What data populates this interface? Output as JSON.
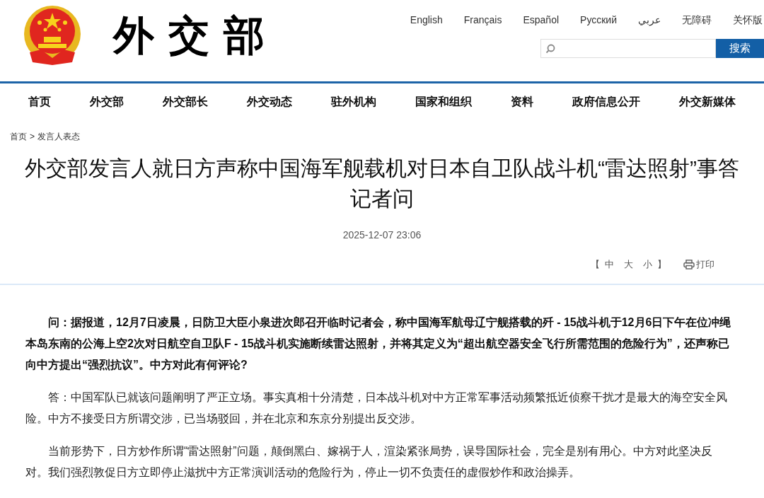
{
  "header": {
    "logo_text": "外交部",
    "languages": [
      "English",
      "Français",
      "Español",
      "Русский",
      "عربي",
      "无障碍",
      "关怀版"
    ],
    "search": {
      "button": "搜索"
    }
  },
  "nav": [
    "首页",
    "外交部",
    "外交部长",
    "外交动态",
    "驻外机构",
    "国家和组织",
    "资料",
    "政府信息公开",
    "外交新媒体"
  ],
  "breadcrumb": {
    "items": [
      "首页",
      "发言人表态"
    ],
    "separator": ">"
  },
  "article": {
    "title": "外交部发言人就日方声称中国海军舰载机对日本自卫队战斗机“雷达照射”事答记者问",
    "date": "2025-12-07 23:06",
    "font_size": {
      "open": "【",
      "options": [
        "中",
        "大",
        "小"
      ],
      "close": "】"
    },
    "print": "打印",
    "paragraphs": [
      {
        "kind": "question",
        "text": "问：据报道，12月7日凌晨，日防卫大臣小泉进次郎召开临时记者会，称中国海军航母辽宁舰搭载的歼 - 15战斗机于12月6日下午在位冲绳本岛东南的公海上空2次对日航空自卫队F - 15战斗机实施断续雷达照射，并将其定义为“超出航空器安全飞行所需范围的危险行为”，还声称已向中方提出“强烈抗议”。中方对此有何评论?"
      },
      {
        "kind": "answer",
        "text": "答：中国军队已就该问题阐明了严正立场。事实真相十分清楚，日本战斗机对中方正常军事活动频繁抵近侦察干扰才是最大的海空安全风险。中方不接受日方所谓交涉，已当场驳回，并在北京和东京分别提出反交涉。"
      },
      {
        "kind": "answer",
        "text": "当前形势下，日方炒作所谓“雷达照射”问题，颠倒黑白、嫁祸于人，渲染紧张局势，误导国际社会，完全是别有用心。中方对此坚决反对。我们强烈敦促日方立即停止滋扰中方正常演训活动的危险行为，停止一切不负责任的虚假炒作和政治操弄。"
      }
    ]
  }
}
